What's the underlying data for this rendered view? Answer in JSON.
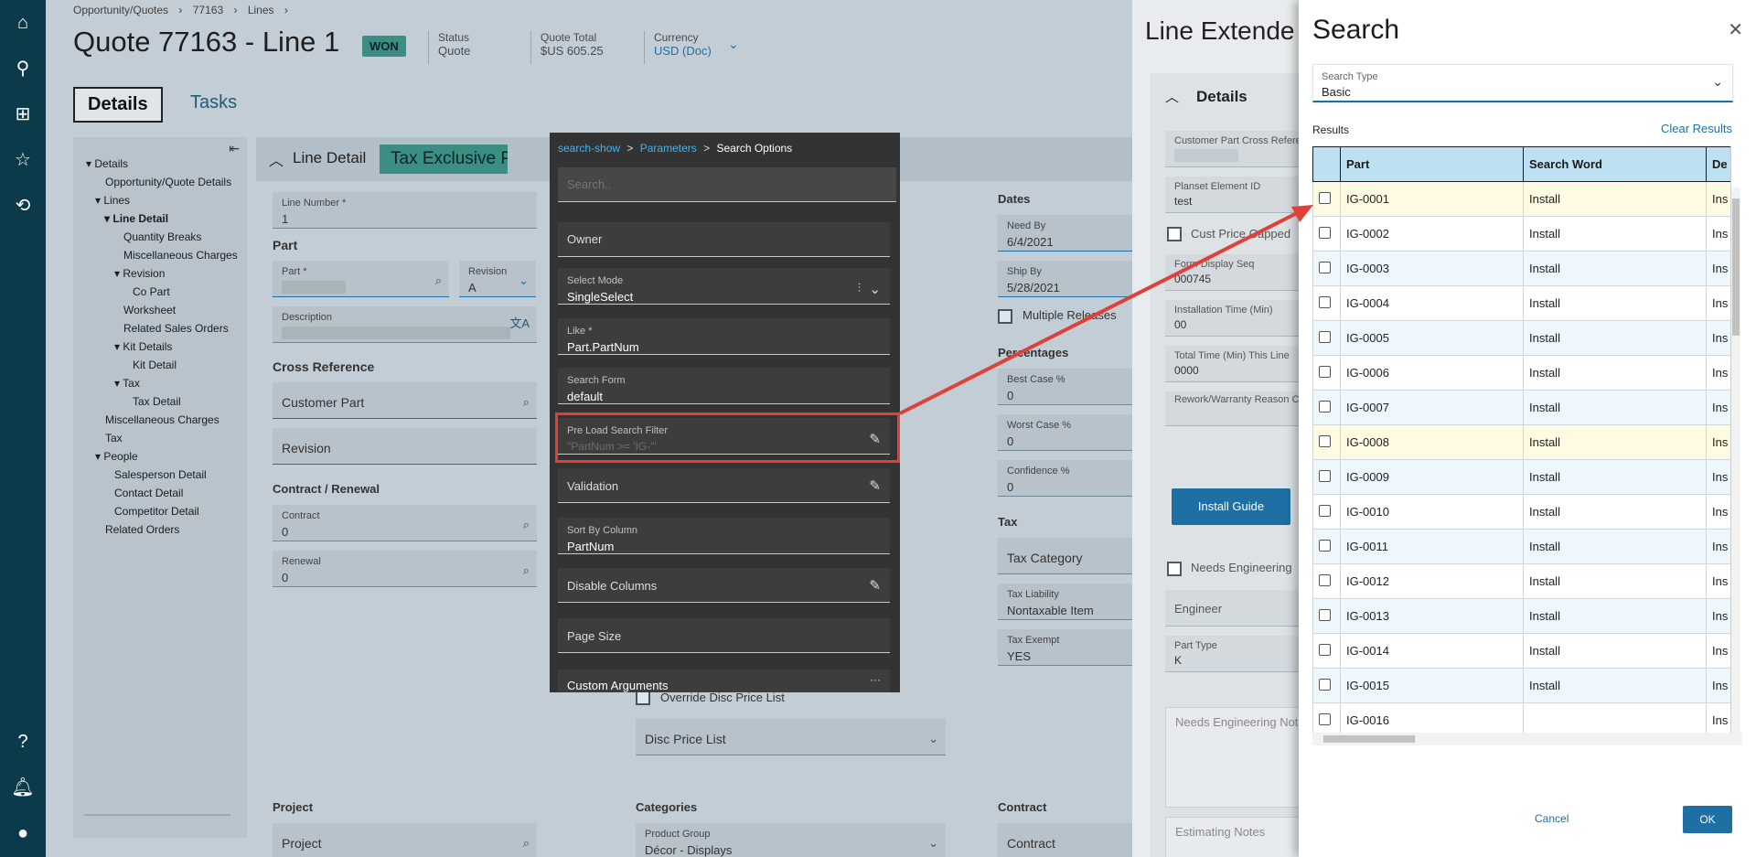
{
  "leftnav": {
    "icons": [
      "home-icon",
      "search-icon",
      "apps-grid-icon",
      "star-icon",
      "history-icon",
      "help-icon",
      "bell-icon",
      "user-icon"
    ]
  },
  "header": {
    "breadcrumb": [
      "Opportunity/Quotes",
      "77163",
      "Lines"
    ],
    "title": "Quote 77163 - Line 1",
    "badge": "WON",
    "status_label": "Status",
    "status_value": "Quote",
    "total_label": "Quote Total",
    "total_value": "$US  605.25",
    "currency_label": "Currency",
    "currency_value": "USD (Doc)"
  },
  "tabs": {
    "details": "Details",
    "tasks": "Tasks"
  },
  "tree": [
    "Details",
    "Opportunity/Quote Details",
    "Lines",
    "Line Detail",
    "Quantity Breaks",
    "Miscellaneous Charges",
    "Revision",
    "Co Part",
    "Worksheet",
    "Related Sales Orders",
    "Kit Details",
    "Kit Detail",
    "Tax",
    "Tax Detail",
    "Miscellaneous Charges",
    "Tax",
    "People",
    "Salesperson Detail",
    "Contact Detail",
    "Competitor Detail",
    "Related Orders"
  ],
  "line_detail": {
    "section_title": "Line Detail",
    "banner": "Tax Exclusive Pri",
    "line_number_label": "Line Number *",
    "line_number_value": "1",
    "part_heading": "Part",
    "part_label": "Part *",
    "revision_label": "Revision",
    "revision_value": "A",
    "description_label": "Description",
    "cross_ref_heading": "Cross Reference",
    "customer_part": "Customer Part",
    "revision_field": "Revision",
    "contract_heading": "Contract / Renewal",
    "contract_label": "Contract",
    "contract_value": "0",
    "renewal_label": "Renewal",
    "renewal_value": "0",
    "project_heading": "Project",
    "project_field": "Project",
    "categories_heading": "Categories",
    "product_group_label": "Product Group",
    "product_group_value": "Décor - Displays",
    "contract2_heading": "Contract",
    "contract2_field": "Contract",
    "override_disc": "Override Disc Price List",
    "disc_price_list": "Disc Price List"
  },
  "dates": {
    "heading": "Dates",
    "need_by_label": "Need By",
    "need_by_value": "6/4/2021",
    "ship_by_label": "Ship By",
    "ship_by_value": "5/28/2021",
    "multiple_releases": "Multiple Releases",
    "pct_heading": "Percentages",
    "best_label": "Best Case %",
    "best_value": "0",
    "worst_label": "Worst Case %",
    "worst_value": "0",
    "conf_label": "Confidence %",
    "conf_value": "0",
    "tax_heading": "Tax",
    "tax_category": "Tax Category",
    "tax_liability_label": "Tax Liability",
    "tax_liability_value": "Nontaxable Item",
    "tax_exempt_label": "Tax Exempt",
    "tax_exempt_value": "YES"
  },
  "search_options": {
    "crumb1": "search-show",
    "crumb2": "Parameters",
    "crumb3": "Search Options",
    "search_placeholder": "Search..",
    "owner": "Owner",
    "select_mode_label": "Select Mode",
    "select_mode_value": "SingleSelect",
    "like_label": "Like *",
    "like_value": "Part.PartNum",
    "search_form_label": "Search Form",
    "search_form_value": "default",
    "preload_label": "Pre Load Search Filter",
    "preload_value": "\"PartNum >= 'IG-'\"",
    "validation": "Validation",
    "sort_by_label": "Sort By Column",
    "sort_by_value": "PartNum",
    "disable_columns": "Disable Columns",
    "page_size": "Page Size",
    "custom_arguments": "Custom Arguments"
  },
  "line_extended": {
    "title": "Line Extende",
    "details": "Details",
    "cust_part_xref_label": "Customer Part Cross Refere",
    "planset_label": "Planset Element ID",
    "planset_value": "test",
    "cust_price_capped": "Cust Price Capped",
    "form_display_label": "Form Display Seq",
    "form_display_value": "000745",
    "install_time_label": "Installation Time (Min)",
    "install_time_value": "00",
    "total_time_label": "Total Time (Min) This Line",
    "total_time_value": "0000",
    "rework_label": "Rework/Warranty Reason Co",
    "install_guide": "Install Guide",
    "needs_engineering": "Needs Engineering",
    "engineer": "Engineer",
    "part_type_label": "Part Type",
    "part_type_value": "K",
    "needs_eng_notes": "Needs Engineering Not",
    "estimating_notes": "Estimating Notes"
  },
  "search": {
    "title": "Search",
    "search_type_label": "Search Type",
    "search_type_value": "Basic",
    "results_label": "Results",
    "clear_results": "Clear Results",
    "columns": [
      "Part",
      "Search Word",
      "De"
    ],
    "rows": [
      {
        "part": "IG-0001",
        "word": "Install",
        "desc": "Ins"
      },
      {
        "part": "IG-0002",
        "word": "Install",
        "desc": "Ins"
      },
      {
        "part": "IG-0003",
        "word": "Install",
        "desc": "Ins"
      },
      {
        "part": "IG-0004",
        "word": "Install",
        "desc": "Ins"
      },
      {
        "part": "IG-0005",
        "word": "Install",
        "desc": "Ins"
      },
      {
        "part": "IG-0006",
        "word": "Install",
        "desc": "Ins"
      },
      {
        "part": "IG-0007",
        "word": "Install",
        "desc": "Ins"
      },
      {
        "part": "IG-0008",
        "word": "Install",
        "desc": "Ins"
      },
      {
        "part": "IG-0009",
        "word": "Install",
        "desc": "Ins"
      },
      {
        "part": "IG-0010",
        "word": "Install",
        "desc": "Ins"
      },
      {
        "part": "IG-0011",
        "word": "Install",
        "desc": "Ins"
      },
      {
        "part": "IG-0012",
        "word": "Install",
        "desc": "Ins"
      },
      {
        "part": "IG-0013",
        "word": "Install",
        "desc": "Ins"
      },
      {
        "part": "IG-0014",
        "word": "Install",
        "desc": "Ins"
      },
      {
        "part": "IG-0015",
        "word": "Install",
        "desc": "Ins"
      },
      {
        "part": "IG-0016",
        "word": "",
        "desc": "Ins"
      }
    ],
    "cancel": "Cancel",
    "ok": "OK"
  },
  "colors": {
    "nav": "#0b3b4b",
    "accent": "#1e6fa3",
    "highlight_box": "#e0403a",
    "won_badge": "#3b8e83"
  }
}
